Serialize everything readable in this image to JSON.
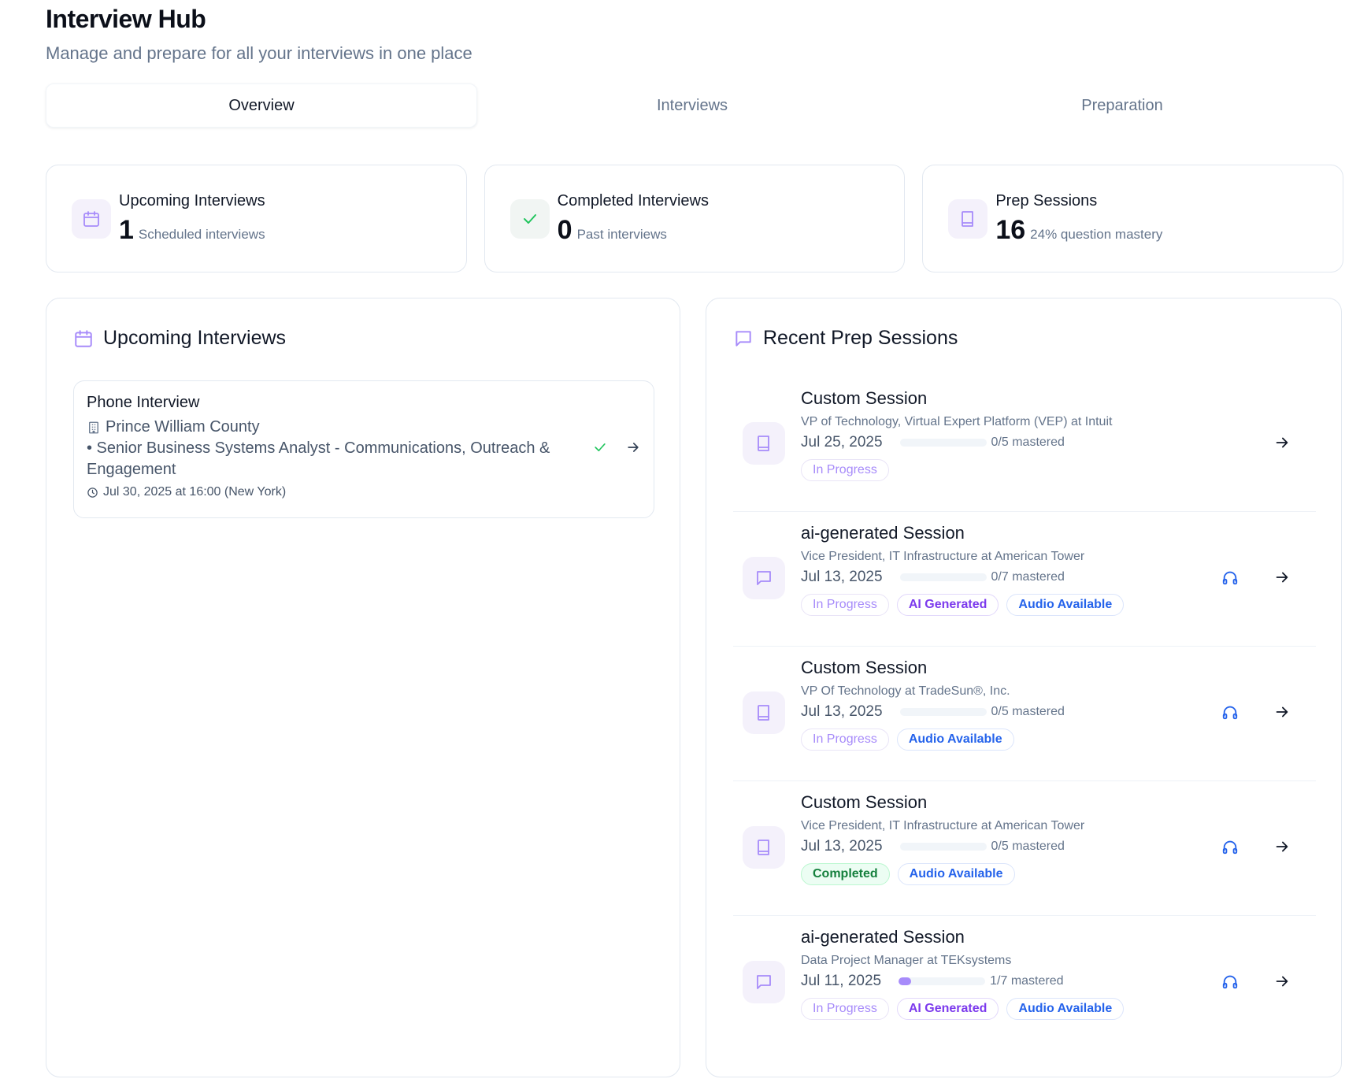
{
  "header": {
    "title": "Interview Hub",
    "subtitle": "Manage and prepare for all your interviews in one place"
  },
  "tabs": [
    {
      "label": "Overview",
      "active": true
    },
    {
      "label": "Interviews",
      "active": false
    },
    {
      "label": "Preparation",
      "active": false
    }
  ],
  "stats": [
    {
      "label": "Upcoming Interviews",
      "value": "1",
      "sub": "Scheduled interviews",
      "icon": "calendar-icon"
    },
    {
      "label": "Completed Interviews",
      "value": "0",
      "sub": "Past interviews",
      "icon": "check-icon"
    },
    {
      "label": "Prep Sessions",
      "value": "16",
      "sub": "24% question mastery",
      "icon": "book-icon"
    }
  ],
  "upcoming": {
    "title": "Upcoming Interviews",
    "interview": {
      "type": "Phone Interview",
      "company": "Prince William County",
      "role": "• Senior Business Systems Analyst - Communications, Outreach & Engagement",
      "time": "Jul 30, 2025 at 16:00 (New York)"
    }
  },
  "prep": {
    "title": "Recent Prep Sessions",
    "sessions": [
      {
        "title": "Custom Session",
        "role": "VP of Technology, Virtual Expert Platform (VEP) at Intuit",
        "date": "Jul 25, 2025",
        "mastered": "0/5 mastered",
        "progress": 0,
        "icon": "book-icon",
        "audio": false,
        "badges": [
          {
            "label": "In Progress",
            "kind": "in-progress"
          }
        ]
      },
      {
        "title": "ai-generated Session",
        "role": "Vice President, IT Infrastructure at American Tower",
        "date": "Jul 13, 2025",
        "mastered": "0/7 mastered",
        "progress": 0,
        "icon": "message-icon",
        "audio": true,
        "badges": [
          {
            "label": "In Progress",
            "kind": "in-progress"
          },
          {
            "label": "AI Generated",
            "kind": "ai"
          },
          {
            "label": "Audio Available",
            "kind": "audio"
          }
        ]
      },
      {
        "title": "Custom Session",
        "role": "VP Of Technology at TradeSun®, Inc.",
        "date": "Jul 13, 2025",
        "mastered": "0/5 mastered",
        "progress": 0,
        "icon": "book-icon",
        "audio": true,
        "badges": [
          {
            "label": "In Progress",
            "kind": "in-progress"
          },
          {
            "label": "Audio Available",
            "kind": "audio"
          }
        ]
      },
      {
        "title": "Custom Session",
        "role": "Vice President, IT Infrastructure at American Tower",
        "date": "Jul 13, 2025",
        "mastered": "0/5 mastered",
        "progress": 0,
        "icon": "book-icon",
        "audio": true,
        "badges": [
          {
            "label": "Completed",
            "kind": "completed"
          },
          {
            "label": "Audio Available",
            "kind": "audio"
          }
        ]
      },
      {
        "title": "ai-generated Session",
        "role": "Data Project Manager at TEKsystems",
        "date": "Jul 11, 2025",
        "mastered": "1/7 mastered",
        "progress": 0.14,
        "icon": "message-icon",
        "audio": true,
        "badges": [
          {
            "label": "In Progress",
            "kind": "in-progress"
          },
          {
            "label": "AI Generated",
            "kind": "ai"
          },
          {
            "label": "Audio Available",
            "kind": "audio"
          }
        ]
      }
    ]
  }
}
